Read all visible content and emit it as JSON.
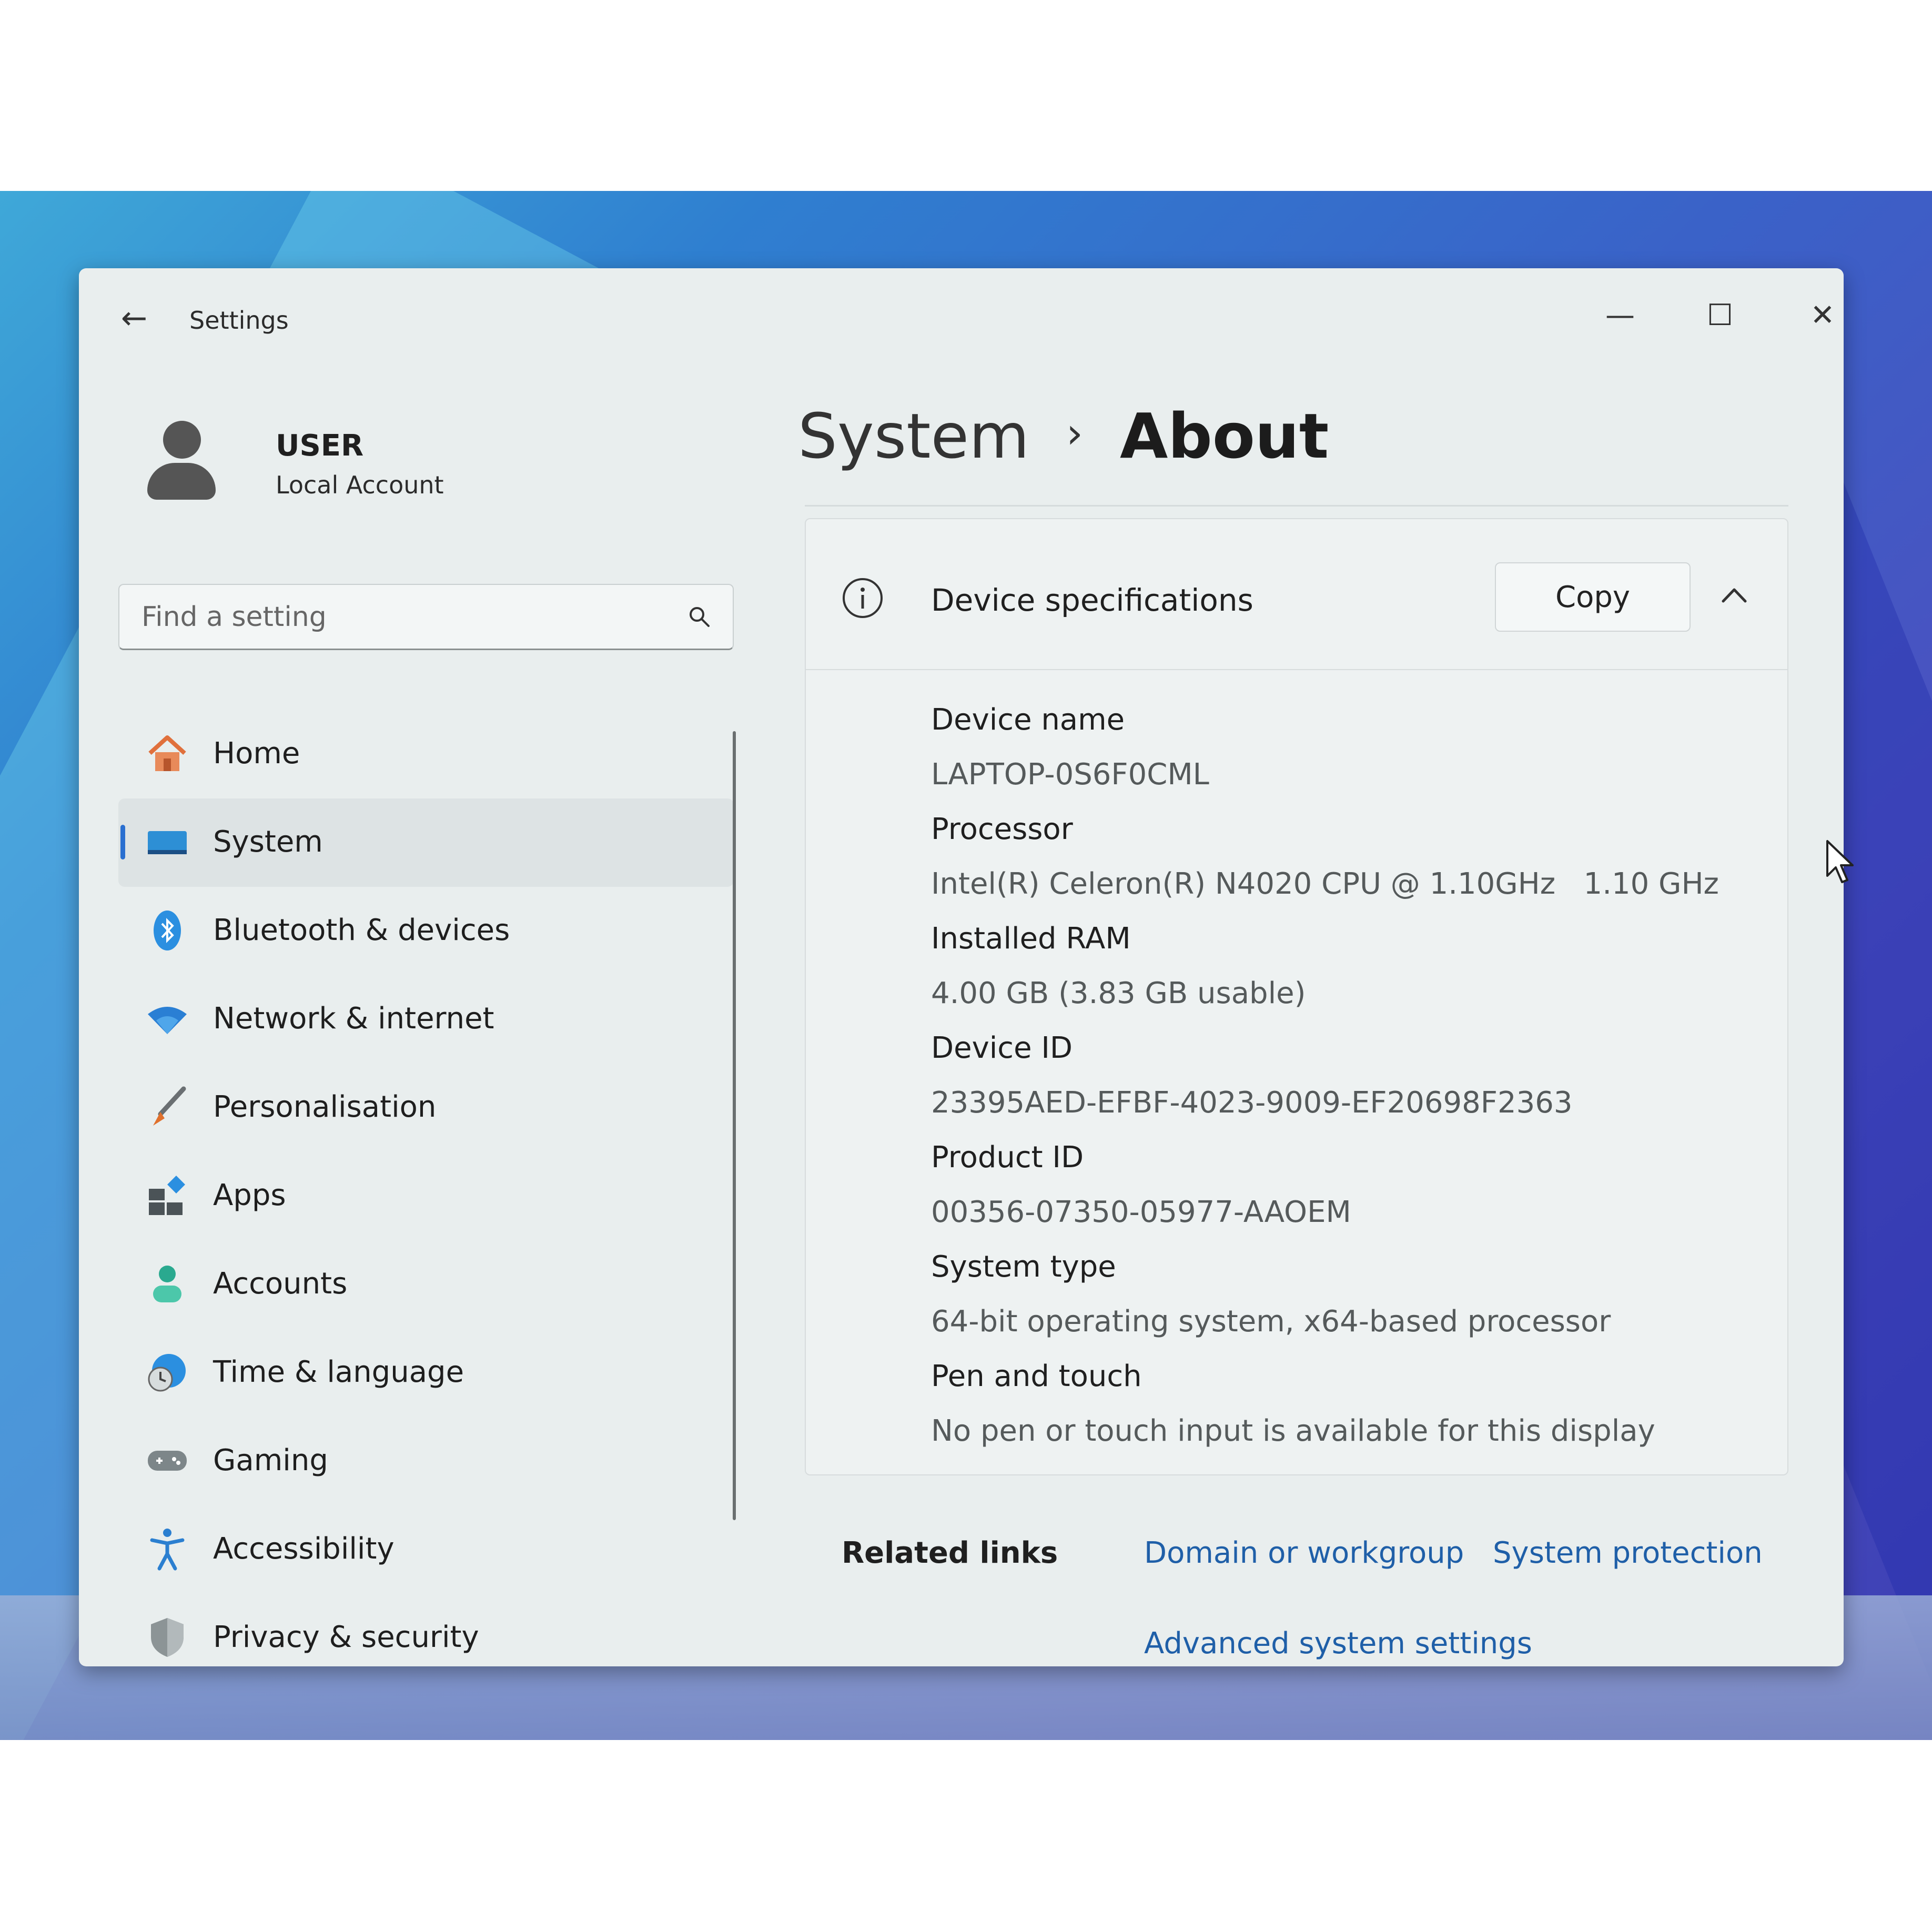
{
  "window": {
    "app_title": "Settings",
    "back_glyph": "←",
    "minimize_glyph": "—",
    "maximize_glyph": "☐",
    "close_glyph": "✕"
  },
  "profile": {
    "name": "USER",
    "account_type": "Local Account"
  },
  "search": {
    "placeholder": "Find a setting",
    "icon": "search-icon"
  },
  "sidebar": {
    "items": [
      {
        "label": "Home",
        "icon": "home-icon",
        "active": false
      },
      {
        "label": "System",
        "icon": "system-icon",
        "active": true
      },
      {
        "label": "Bluetooth & devices",
        "icon": "bluetooth-icon",
        "active": false
      },
      {
        "label": "Network & internet",
        "icon": "wifi-icon",
        "active": false
      },
      {
        "label": "Personalisation",
        "icon": "brush-icon",
        "active": false
      },
      {
        "label": "Apps",
        "icon": "apps-icon",
        "active": false
      },
      {
        "label": "Accounts",
        "icon": "accounts-icon",
        "active": false
      },
      {
        "label": "Time & language",
        "icon": "globe-clock-icon",
        "active": false
      },
      {
        "label": "Gaming",
        "icon": "gamepad-icon",
        "active": false
      },
      {
        "label": "Accessibility",
        "icon": "accessibility-icon",
        "active": false
      },
      {
        "label": "Privacy & security",
        "icon": "shield-icon",
        "active": false
      }
    ]
  },
  "breadcrumb": {
    "parent": "System",
    "separator": "›",
    "current": "About"
  },
  "device_specs": {
    "title": "Device specifications",
    "copy_label": "Copy",
    "collapse_glyph": "^",
    "rows": [
      {
        "label": "Device name",
        "value": "LAPTOP-0S6F0CML"
      },
      {
        "label": "Processor",
        "value": "Intel(R) Celeron(R) N4020 CPU @ 1.10GHz   1.10 GHz"
      },
      {
        "label": "Installed RAM",
        "value": "4.00 GB (3.83 GB usable)"
      },
      {
        "label": "Device ID",
        "value": "23395AED-EFBF-4023-9009-EF20698F2363"
      },
      {
        "label": "Product ID",
        "value": "00356-07350-05977-AAOEM"
      },
      {
        "label": "System type",
        "value": "64-bit operating system, x64-based processor"
      },
      {
        "label": "Pen and touch",
        "value": "No pen or touch input is available for this display"
      }
    ]
  },
  "related_links": {
    "label": "Related links",
    "links": [
      "Domain or workgroup",
      "System protection",
      "Advanced system settings"
    ]
  },
  "colors": {
    "accent": "#2a6fd0",
    "link": "#1f5fa8",
    "window_bg": "#e9eeee"
  }
}
